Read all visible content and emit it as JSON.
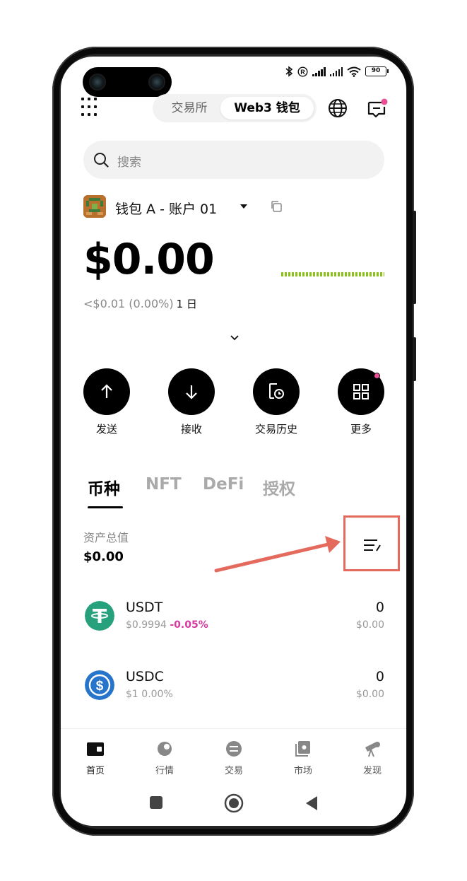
{
  "status": {
    "battery": "90"
  },
  "header": {
    "tab_exchange": "交易所",
    "tab_web3": "Web3 钱包"
  },
  "search": {
    "placeholder": "搜索"
  },
  "account": {
    "name": "钱包 A - 账户 01"
  },
  "balance": {
    "total": "$0.00",
    "change": "<$0.01 (0.00%)",
    "period": "1 日"
  },
  "actions": [
    {
      "label": "发送",
      "icon": "arrow-up-icon"
    },
    {
      "label": "接收",
      "icon": "arrow-down-icon"
    },
    {
      "label": "交易历史",
      "icon": "history-icon"
    },
    {
      "label": "更多",
      "icon": "apps-icon"
    }
  ],
  "tabs": [
    "币种",
    "NFT",
    "DeFi",
    "授权"
  ],
  "assets": {
    "label": "资产总值",
    "value": "$0.00"
  },
  "tokens": [
    {
      "symbol": "USDT",
      "price": "$0.9994",
      "change": "-0.05%",
      "amount": "0",
      "usd": "$0.00",
      "color": "#26a17b"
    },
    {
      "symbol": "USDC",
      "price": "$1",
      "change": "0.00%",
      "amount": "0",
      "usd": "$0.00",
      "color": "#2775ca"
    }
  ],
  "bottom_nav": [
    {
      "label": "首页",
      "icon": "wallet-icon"
    },
    {
      "label": "行情",
      "icon": "market-icon"
    },
    {
      "label": "交易",
      "icon": "swap-icon"
    },
    {
      "label": "市场",
      "icon": "marketplace-icon"
    },
    {
      "label": "发现",
      "icon": "discover-icon"
    }
  ],
  "colors": {
    "accent_pink": "#ea4e93",
    "negative": "#d63b9f",
    "sparkline": "#8bc21a",
    "annotation": "#e56a5e"
  }
}
